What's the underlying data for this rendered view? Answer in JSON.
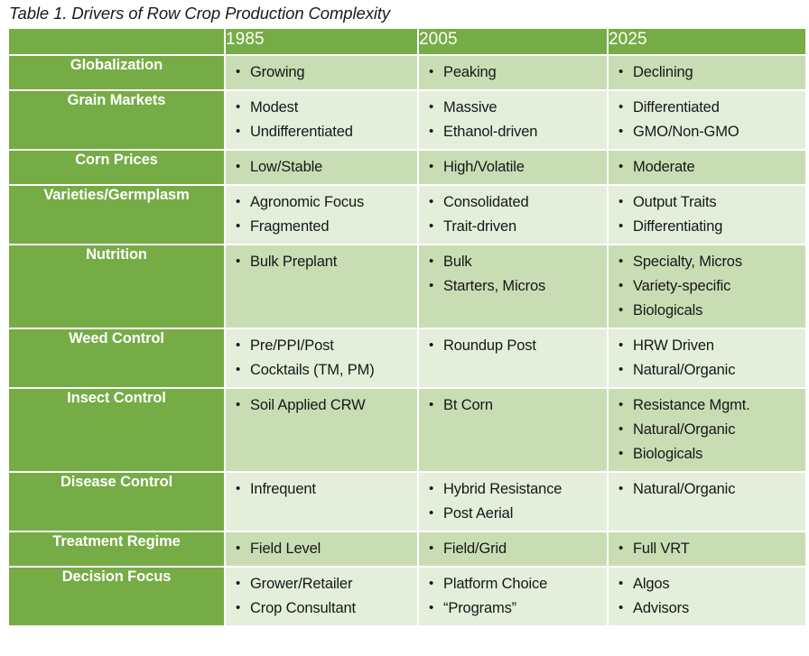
{
  "caption": "Table 1. Drivers of Row Crop Production Complexity",
  "colors": {
    "header_green": "#76ac46",
    "row_label_green": "#76ac46",
    "tint_dark": "#c9ddb4",
    "tint_light": "#e3efda",
    "text_dark": "#171717",
    "text_light": "#ffffff",
    "page_background": "#ffffff"
  },
  "table": {
    "columns": [
      "",
      "1985",
      "2005",
      "2025"
    ],
    "rows": [
      {
        "label": "Globalization",
        "tint": "dark",
        "cells": [
          [
            "Growing"
          ],
          [
            "Peaking"
          ],
          [
            "Declining"
          ]
        ]
      },
      {
        "label": "Grain Markets",
        "tint": "light",
        "cells": [
          [
            "Modest",
            "Undifferentiated"
          ],
          [
            "Massive",
            "Ethanol-driven"
          ],
          [
            "Differentiated",
            "GMO/Non-GMO"
          ]
        ]
      },
      {
        "label": "Corn Prices",
        "tint": "dark",
        "cells": [
          [
            "Low/Stable"
          ],
          [
            "High/Volatile"
          ],
          [
            "Moderate"
          ]
        ]
      },
      {
        "label": "Varieties/Germplasm",
        "tint": "light",
        "cells": [
          [
            "Agronomic Focus",
            "Fragmented"
          ],
          [
            "Consolidated",
            "Trait-driven"
          ],
          [
            "Output Traits",
            "Differentiating"
          ]
        ]
      },
      {
        "label": "Nutrition",
        "tint": "dark",
        "cells": [
          [
            "Bulk Preplant"
          ],
          [
            "Bulk",
            "Starters, Micros"
          ],
          [
            "Specialty, Micros",
            "Variety-specific",
            "Biologicals"
          ]
        ]
      },
      {
        "label": "Weed Control",
        "tint": "light",
        "cells": [
          [
            "Pre/PPI/Post",
            "Cocktails (TM, PM)"
          ],
          [
            "Roundup Post"
          ],
          [
            "HRW Driven",
            "Natural/Organic"
          ]
        ]
      },
      {
        "label": "Insect Control",
        "tint": "dark",
        "cells": [
          [
            "Soil Applied CRW"
          ],
          [
            "Bt Corn"
          ],
          [
            "Resistance Mgmt.",
            "Natural/Organic",
            "Biologicals"
          ]
        ]
      },
      {
        "label": "Disease Control",
        "tint": "light",
        "cells": [
          [
            "Infrequent"
          ],
          [
            "Hybrid Resistance",
            "Post Aerial"
          ],
          [
            "Natural/Organic"
          ]
        ]
      },
      {
        "label": "Treatment Regime",
        "tint": "dark",
        "cells": [
          [
            "Field Level"
          ],
          [
            "Field/Grid"
          ],
          [
            "Full VRT"
          ]
        ]
      },
      {
        "label": "Decision Focus",
        "tint": "light",
        "cells": [
          [
            "Grower/Retailer",
            "Crop Consultant"
          ],
          [
            "Platform Choice",
            "“Programs”"
          ],
          [
            "Algos",
            "Advisors"
          ]
        ]
      }
    ]
  }
}
